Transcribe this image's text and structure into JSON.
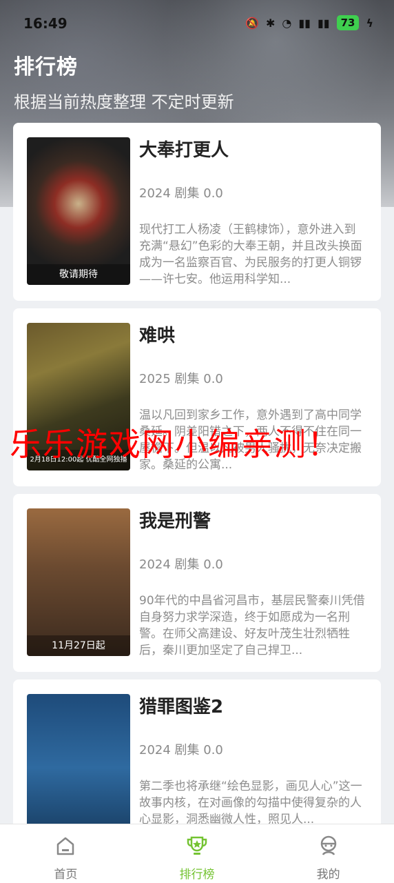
{
  "status_bar": {
    "time": "16:49",
    "battery": "73"
  },
  "header": {
    "title": "排行榜",
    "subtitle": "根据当前热度整理 不定时更新"
  },
  "items": [
    {
      "name": "大奉打更人",
      "meta": "2024 剧集 0.0",
      "desc": "现代打工人杨凌（王鹤棣饰），意外进入到充满“悬幻”色彩的大奉王朝，并且改头换面成为一名监察百官、为民服务的打更人铜锣——许七安。他运用科学知...",
      "poster_tag": "敬请期待"
    },
    {
      "name": "难哄",
      "meta": "2025 剧集 0.0",
      "desc": "温以凡回到家乡工作，意外遇到了高中同学桑延。阴差阳错之下，两人不得不住在同一屋檐下。但温以凡被男人骚扰，无奈决定搬家。桑延的公寓...",
      "poster_tag": "2月18日12:00起 优酷全网独播"
    },
    {
      "name": "我是刑警",
      "meta": "2024 剧集 0.0",
      "desc": "90年代的中昌省河昌市，基层民警秦川凭借自身努力求学深造，终于如愿成为一名刑警。在师父高建设、好友叶茂生壮烈牺牲后，秦川更加坚定了自己捍卫...",
      "poster_tag": "11月27日起"
    },
    {
      "name": "猎罪图鉴2",
      "meta": "2024 剧集 0.0",
      "desc": "第二季也将承继“绘色显影，画见人心”这一故事内核，在对画像的勾描中使得复杂的人心显影，洞悉幽微人性，照见人...",
      "poster_tag": ""
    }
  ],
  "watermark": "乐乐游戏网小编亲测！",
  "tabbar": [
    {
      "label": "首页",
      "icon": "home-icon"
    },
    {
      "label": "排行榜",
      "icon": "trophy-icon"
    },
    {
      "label": "我的",
      "icon": "profile-icon"
    }
  ],
  "colors": {
    "accent": "#74c332",
    "watermark": "#ff0000"
  }
}
